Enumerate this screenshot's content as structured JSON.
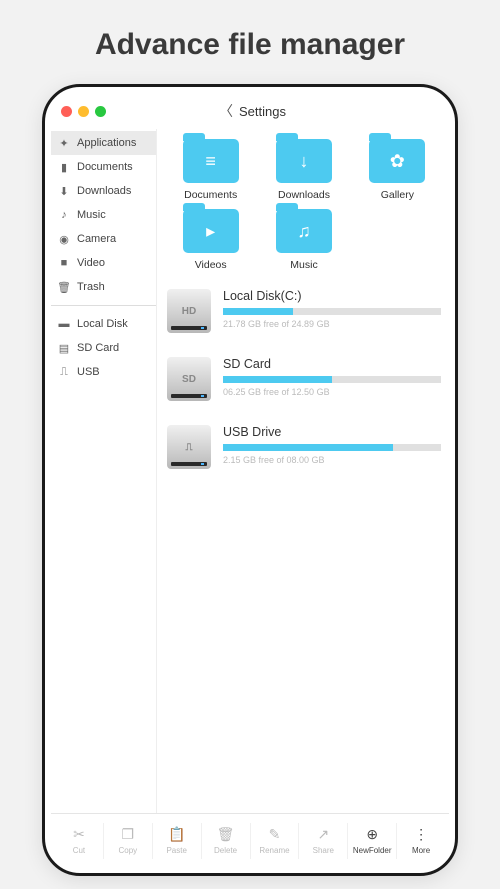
{
  "page_title": "Advance file manager",
  "header": {
    "title": "Settings"
  },
  "sidebar": {
    "items": [
      {
        "label": "Applications",
        "icon": "apps"
      },
      {
        "label": "Documents",
        "icon": "doc"
      },
      {
        "label": "Downloads",
        "icon": "download"
      },
      {
        "label": "Music",
        "icon": "music"
      },
      {
        "label": "Camera",
        "icon": "camera"
      },
      {
        "label": "Video",
        "icon": "video"
      },
      {
        "label": "Trash",
        "icon": "trash"
      }
    ],
    "storage": [
      {
        "label": "Local Disk",
        "icon": "disk"
      },
      {
        "label": "SD Card",
        "icon": "sd"
      },
      {
        "label": "USB",
        "icon": "usb"
      }
    ]
  },
  "folders": [
    {
      "label": "Documents",
      "glyph": "≡"
    },
    {
      "label": "Downloads",
      "glyph": "↓"
    },
    {
      "label": "Gallery",
      "glyph": "✿"
    },
    {
      "label": "Videos",
      "glyph": "▸"
    },
    {
      "label": "Music",
      "glyph": "♫"
    }
  ],
  "disks": [
    {
      "tag": "HD",
      "name": "Local Disk(C:)",
      "free_text": "21.78 GB free of 24.89 GB",
      "percent": 32
    },
    {
      "tag": "SD",
      "name": "SD Card",
      "free_text": "06.25 GB free of 12.50 GB",
      "percent": 50
    },
    {
      "tag": "⎍",
      "name": "USB Drive",
      "free_text": "2.15 GB free of 08.00 GB",
      "percent": 78
    }
  ],
  "toolbar": [
    {
      "label": "Cut",
      "glyph": "✂"
    },
    {
      "label": "Copy",
      "glyph": "❐"
    },
    {
      "label": "Paste",
      "glyph": "📋"
    },
    {
      "label": "Delete",
      "glyph": "🗑"
    },
    {
      "label": "Rename",
      "glyph": "✎"
    },
    {
      "label": "Share",
      "glyph": "↗"
    },
    {
      "label": "NewFolder",
      "glyph": "⊕"
    },
    {
      "label": "More",
      "glyph": "⋮"
    }
  ]
}
